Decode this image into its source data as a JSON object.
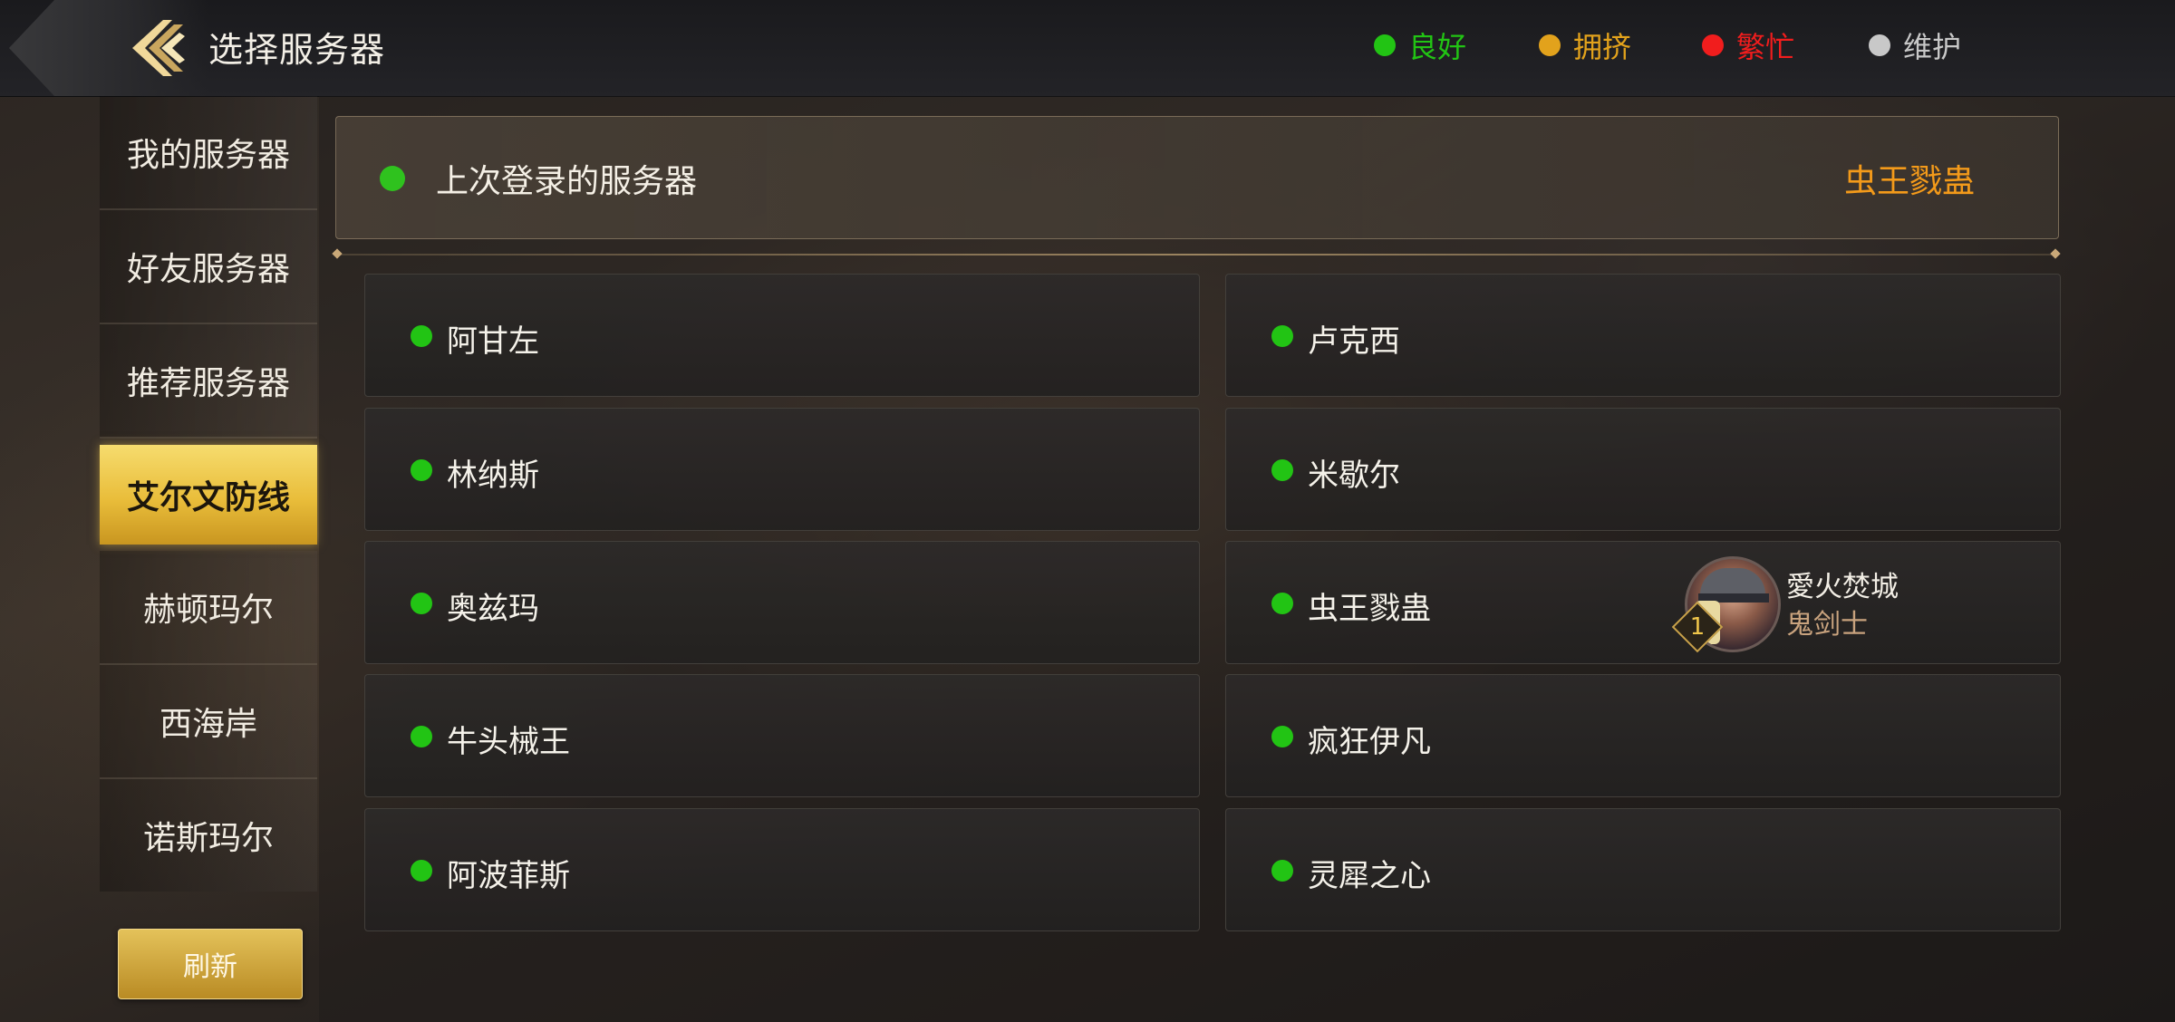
{
  "header": {
    "title": "选择服务器",
    "legend": [
      {
        "label": "良好",
        "color": "#22c414"
      },
      {
        "label": "拥挤",
        "color": "#e2a21c"
      },
      {
        "label": "繁忙",
        "color": "#f11d1d"
      },
      {
        "label": "维护",
        "color": "#c8c8c8"
      }
    ]
  },
  "sidebar": {
    "items": [
      {
        "label": "我的服务器"
      },
      {
        "label": "好友服务器"
      },
      {
        "label": "推荐服务器"
      },
      {
        "label": "艾尔文防线",
        "active": true
      },
      {
        "label": "赫顿玛尔"
      },
      {
        "label": "西海岸"
      },
      {
        "label": "诺斯玛尔"
      }
    ],
    "refresh_label": "刷新"
  },
  "last_login": {
    "label": "上次登录的服务器",
    "server": "虫王戮蛊",
    "status_color": "#2fc21e"
  },
  "servers": [
    {
      "name": "阿甘左"
    },
    {
      "name": "卢克西"
    },
    {
      "name": "林纳斯"
    },
    {
      "name": "米歇尔"
    },
    {
      "name": "奥兹玛"
    },
    {
      "name": "虫王戮蛊"
    },
    {
      "name": "牛头械王"
    },
    {
      "name": "疯狂伊凡"
    },
    {
      "name": "阿波菲斯"
    },
    {
      "name": "灵犀之心"
    }
  ],
  "character": {
    "name": "愛火焚城",
    "class": "鬼剑士",
    "rank": "1"
  }
}
